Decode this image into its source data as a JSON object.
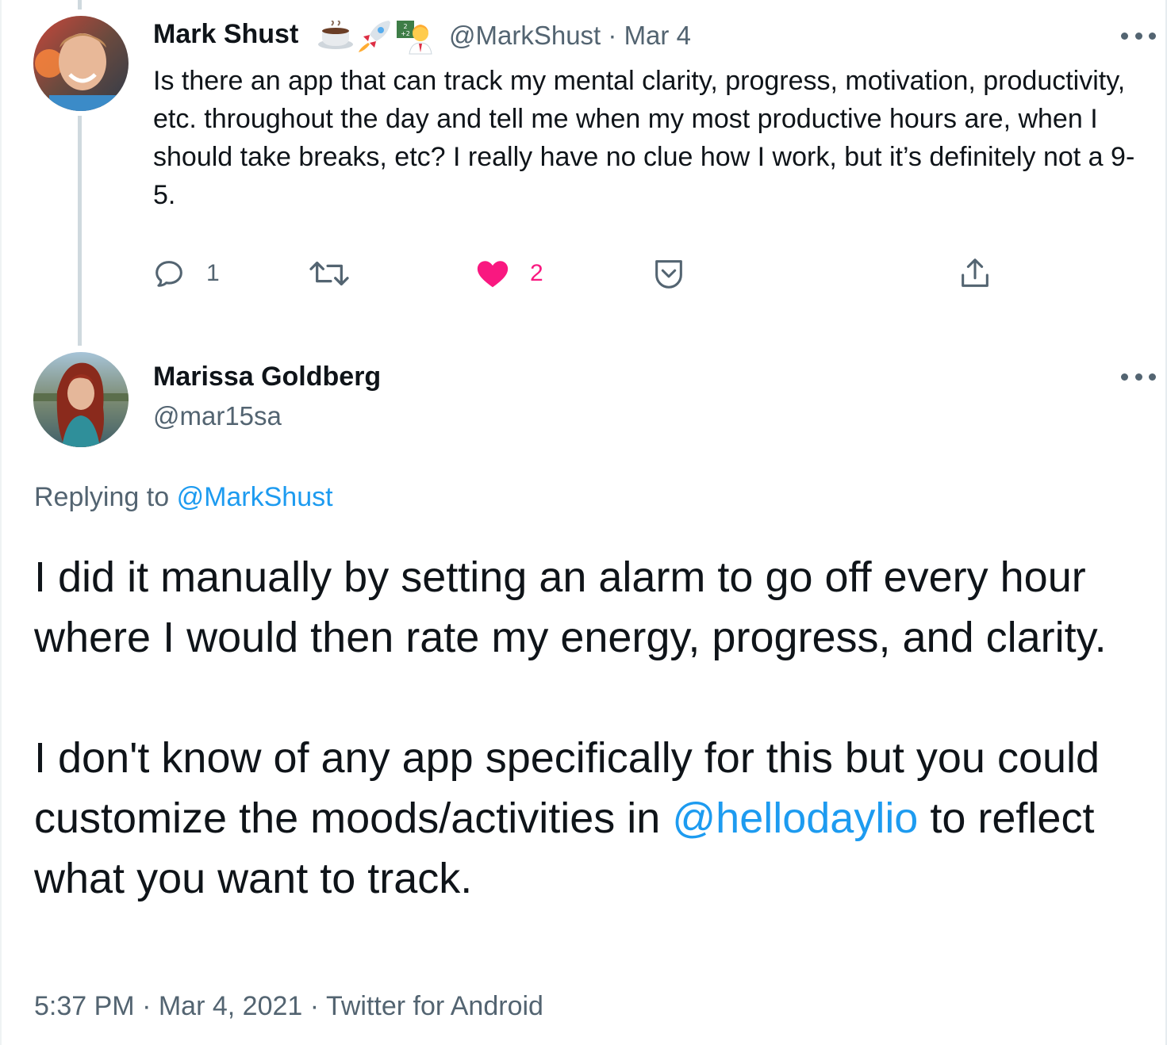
{
  "parent_tweet": {
    "author_name": "Mark Shust",
    "author_emojis": [
      "coffee-icon",
      "rocket-icon",
      "teacher-icon"
    ],
    "handle": "@MarkShust",
    "separator": "·",
    "date": "Mar 4",
    "text": "Is there an app that can track my mental clarity, progress, motivation, productivity, etc. throughout the day and tell me when my most productive hours are, when I should take breaks, etc? I really have no clue how I work, but it’s definitely not a 9-5.",
    "actions": {
      "reply_count": "1",
      "retweet_count": "",
      "like_count": "2",
      "like_color": "#f91880",
      "icons": [
        "reply-icon",
        "retweet-icon",
        "like-icon",
        "bookmark-icon",
        "share-icon"
      ]
    }
  },
  "reply_tweet": {
    "author_name": "Marissa Goldberg",
    "handle": "@mar15sa",
    "replying_to_prefix": "Replying to",
    "replying_to_handle": "@MarkShust",
    "paragraph1": "I did it manually by setting an alarm to go off every hour where I would then rate my energy, progress, and clarity.",
    "paragraph2_before": "I don't know of any app specifically for this but you could customize the moods/activities in",
    "paragraph2_mention": "@hellodaylio",
    "paragraph2_after": "to reflect what you want to track.",
    "time": "5:37 PM",
    "separator": "·",
    "date": "Mar 4, 2021",
    "source": "Twitter for Android"
  },
  "colors": {
    "link": "#1d9bf0",
    "secondary_text": "#536471",
    "primary_text": "#0f1419",
    "like": "#f91880",
    "thread_line": "#cfd9de"
  }
}
